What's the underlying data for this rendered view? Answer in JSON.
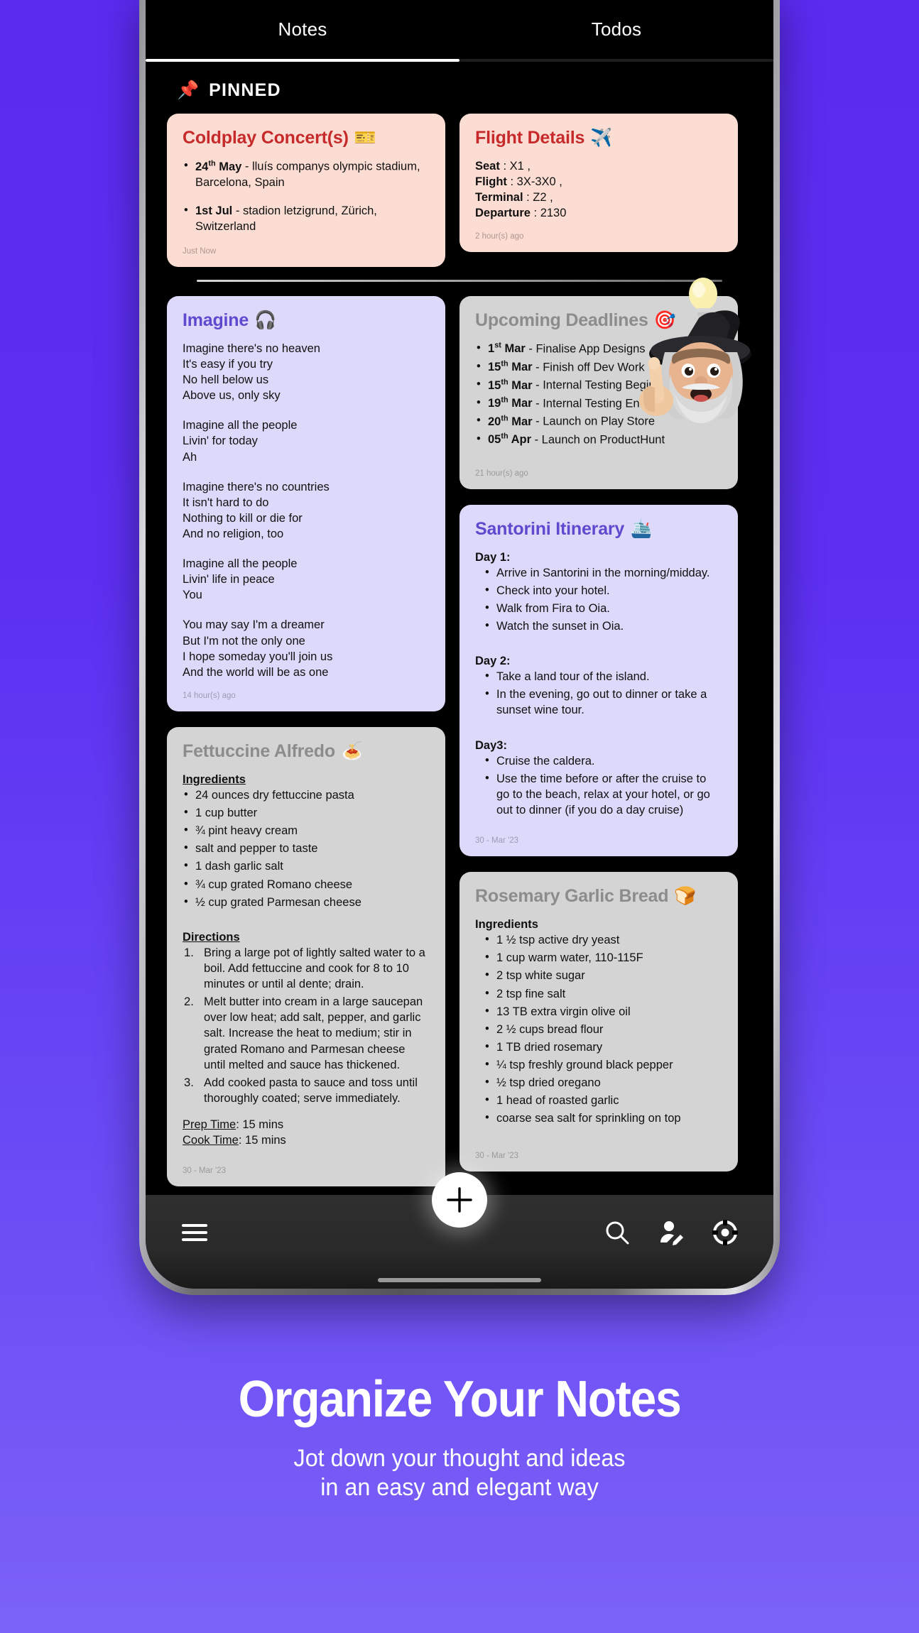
{
  "tabs": [
    {
      "label": "Notes",
      "active": true
    },
    {
      "label": "Todos",
      "active": false
    }
  ],
  "pinned_section": {
    "icon": "pushpin-icon",
    "icon_glyph": "📌",
    "label": "PINNED"
  },
  "pinned_notes": [
    {
      "title": "Coldplay Concert(s)",
      "emoji": "🎫",
      "theme": "peach",
      "items": [
        {
          "bold": "24",
          "sup": "th",
          "bold_tail": " May",
          "rest": " - lluís companys olympic stadium, Barcelona, Spain"
        },
        {
          "bold": "1st Jul",
          "sup": "",
          "bold_tail": "",
          "rest": " - stadion letzigrund, Zürich, Switzerland"
        }
      ],
      "timestamp": "Just Now"
    },
    {
      "title": "Flight Details",
      "emoji": "✈️",
      "theme": "peach",
      "lines": [
        {
          "label": "Seat",
          "value": " : X1 ,"
        },
        {
          "label": "Flight",
          "value": " : 3X-3X0 ,"
        },
        {
          "label": "Terminal",
          "value": " : Z2 ,"
        },
        {
          "label": "Departure",
          "value": " : 2130"
        }
      ],
      "timestamp": "2 hour(s) ago"
    }
  ],
  "notes": {
    "imagine": {
      "title": "Imagine",
      "emoji": "🎧",
      "theme": "lilac",
      "verses": [
        [
          "Imagine there's no heaven",
          "It's easy if you try",
          "No hell below us",
          "Above us, only sky"
        ],
        [
          "Imagine all the people",
          "Livin' for today",
          "Ah"
        ],
        [
          "Imagine there's no countries",
          "It isn't hard to do",
          "Nothing to kill or die for",
          "And no religion, too"
        ],
        [
          "Imagine all the people",
          "Livin' life in peace",
          "You"
        ],
        [
          "You may say I'm a dreamer",
          "But I'm not the only one",
          "I hope someday you'll join us",
          "And the world will be as one"
        ]
      ],
      "timestamp": "14 hour(s) ago"
    },
    "deadlines": {
      "title": "Upcoming Deadlines",
      "emoji": "🎯",
      "theme": "grey",
      "items": [
        {
          "day": "1",
          "sup": "st",
          "month": " Mar",
          "rest": " - Finalise App Designs"
        },
        {
          "day": "15",
          "sup": "th",
          "month": " Mar",
          "rest": " - Finish off Dev Work"
        },
        {
          "day": "15",
          "sup": "th",
          "month": " Mar",
          "rest": " - Internal Testing Begins"
        },
        {
          "day": "19",
          "sup": "th",
          "month": " Mar",
          "rest": " - Internal Testing Ends"
        },
        {
          "day": "20",
          "sup": "th",
          "month": " Mar",
          "rest": " - Launch on Play Store"
        },
        {
          "day": "05",
          "sup": "th",
          "month": " Apr",
          "rest": " - Launch on ProductHunt"
        }
      ],
      "timestamp": "21 hour(s) ago"
    },
    "santorini": {
      "title": "Santorini Itinerary",
      "emoji": "🛳️",
      "theme": "lilac",
      "days": [
        {
          "heading": "Day 1:",
          "items": [
            "Arrive in Santorini in the morning/midday.",
            "Check into your hotel.",
            "Walk from Fira to Oia.",
            "Watch the sunset in Oia."
          ]
        },
        {
          "heading": "Day 2:",
          "items": [
            "Take a land tour of the island.",
            "In the evening, go out to dinner or take a sunset wine tour."
          ]
        },
        {
          "heading": "Day3:",
          "items": [
            "Cruise the caldera.",
            "Use the time before or after the cruise to go to the beach, relax at your hotel, or go out to dinner (if you do a day cruise)"
          ]
        }
      ],
      "timestamp": "30 - Mar '23"
    },
    "fettuccine": {
      "title": "Fettuccine Alfredo",
      "emoji": "🍝",
      "theme": "grey",
      "ingredients_heading": "Ingredients",
      "ingredients": [
        "24 ounces dry fettuccine pasta",
        "1 cup butter",
        "¾ pint heavy cream",
        "salt and pepper to taste",
        "1 dash garlic salt",
        "¾ cup grated Romano cheese",
        "½ cup grated Parmesan cheese"
      ],
      "directions_heading": "Directions",
      "directions": [
        "Bring a large pot of lightly salted water to a boil. Add fettuccine and cook for 8 to 10 minutes or until al dente; drain.",
        "Melt butter into cream in a large saucepan over low heat; add salt, pepper, and garlic salt. Increase the heat to medium; stir in grated Romano and Parmesan cheese until melted and sauce has thickened.",
        "Add cooked pasta to sauce and toss until thoroughly coated; serve immediately."
      ],
      "prep_label": "Prep Time",
      "prep_value": ": 15 mins",
      "cook_label": "Cook Time",
      "cook_value": ": 15 mins",
      "timestamp": "30 - Mar '23"
    },
    "rosemary": {
      "title": "Rosemary Garlic Bread",
      "emoji": "🍞",
      "theme": "grey",
      "ingredients_heading": "Ingredients",
      "ingredients": [
        "1 ½ tsp active dry yeast",
        "1 cup warm water, 110-115F",
        "2 tsp white sugar",
        "2 tsp fine salt",
        "13 TB extra virgin olive oil",
        "2 ½ cups bread flour",
        "1 TB dried rosemary",
        "¼ tsp freshly ground black pepper",
        "½ tsp dried oregano",
        "1 head of roasted garlic",
        "coarse sea salt for sprinkling on top"
      ],
      "timestamp": "30 - Mar '23"
    }
  },
  "bottom_nav": {
    "menu_icon": "hamburger-menu-icon",
    "add_icon": "plus-icon",
    "search_icon": "search-icon",
    "profile_icon": "edit-profile-icon",
    "settings_icon": "life-ring-settings-icon"
  },
  "marketing": {
    "headline": "Organize Your Notes",
    "subhead_line1": "Jot down your thought and ideas",
    "subhead_line2": "in an easy and elegant way"
  },
  "colors": {
    "background_top": "#5B2BF0",
    "background_bottom": "#7B62F7",
    "peach_card": "#FCDDD3",
    "lilac_card": "#DDD9FA",
    "grey_card": "#D4D4D4",
    "title_red": "#C62A2A",
    "title_purple": "#6049CF",
    "title_grey": "#8C8C8C"
  }
}
